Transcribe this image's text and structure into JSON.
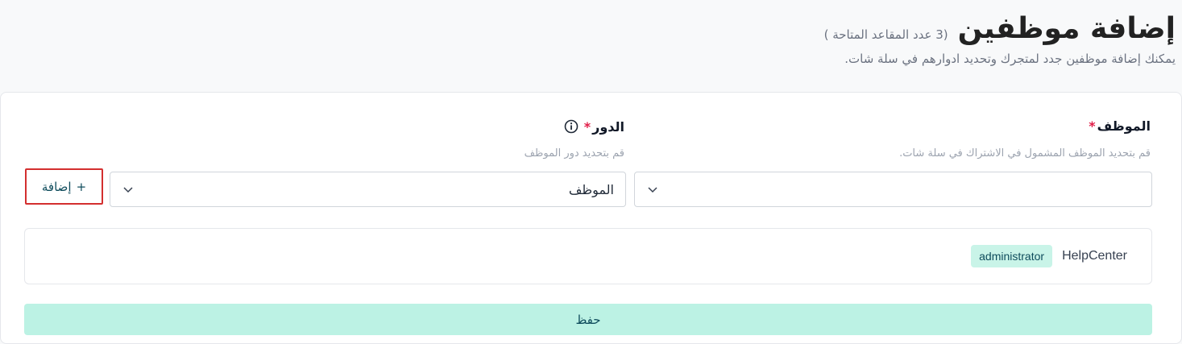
{
  "header": {
    "title": "إضافة موظفين",
    "seats_note": "(3 عدد المقاعد المتاحة )",
    "subtitle": "يمكنك إضافة موظفين جدد لمتجرك وتحديد ادوارهم في سلة شات."
  },
  "form": {
    "employee_field": {
      "label": "الموظف",
      "required_mark": "*",
      "hint": "قم بتحديد الموظف المشمول في الاشتراك في سلة شات.",
      "value": ""
    },
    "role_field": {
      "label": "الدور",
      "required_mark": "*",
      "hint": "قم بتحديد دور الموظف",
      "value": "الموظف"
    },
    "add_button": {
      "label": "إضافة",
      "icon_text": "+"
    }
  },
  "employees": [
    {
      "name": "HelpCenter",
      "role": "administrator"
    }
  ],
  "save_button": {
    "label": "حفظ"
  },
  "colors": {
    "accent": "#bcf2e4",
    "badge_bg": "#c9f4e8",
    "text_dark": "#0f4c5c",
    "required": "#e11d48",
    "highlight_border": "#d32f2f"
  },
  "icons": {
    "dropdown": "chevron-down-icon",
    "info": "info-icon"
  }
}
